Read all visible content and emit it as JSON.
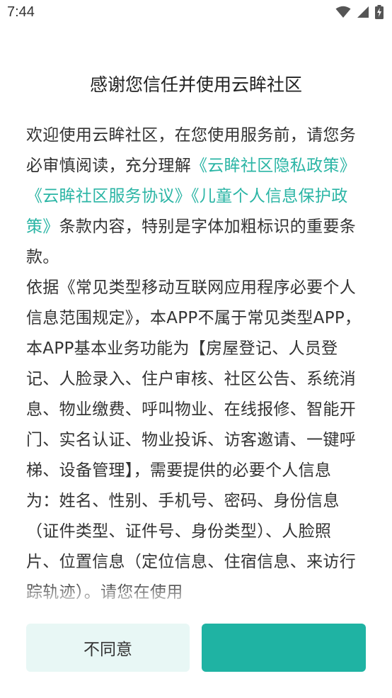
{
  "status_bar": {
    "time": "7:44",
    "icons": [
      "wifi-icon",
      "signal-icon",
      "battery-charging-icon"
    ]
  },
  "dialog": {
    "title": "感谢您信任并使用云眸社区",
    "paragraph1": {
      "intro": "欢迎使用云眸社区，在您使用服务前，请您务必审慎阅读，充分理解",
      "link_privacy": "《云眸社区隐私政策》",
      "link_service": "《云眸社区服务协议》",
      "link_children": "《儿童个人信息保护政策》",
      "outro": "条款内容，特别是字体加粗标识的重要条款。"
    },
    "paragraph2": {
      "text": "依据《常见类型移动互联网应用程序必要个人信息范围规定》，本APP不属于常见类型APP，本APP基本业务功能为【房屋登记、人员登记、人脸录入、住户审核、社区公告、系统消息、物业缴费、呼叫物业、在线报修、智能开门、实名认证、物业投诉、访客邀请、一键呼梯、设备管理】，需要提供的必要个人信息为：姓名、性别、手机号、密码、身份信息（证件类型、证件号、身份类型）、人脸照片、位置信息（定位信息、住宿信息、来访行踪轨迹）。请您在使用"
    },
    "disagree_label": "不同意",
    "agree_label": ""
  },
  "colors": {
    "accent": "#1fb3a3",
    "link": "#2bb5a5",
    "disagree_bg": "#e8f7f5"
  }
}
